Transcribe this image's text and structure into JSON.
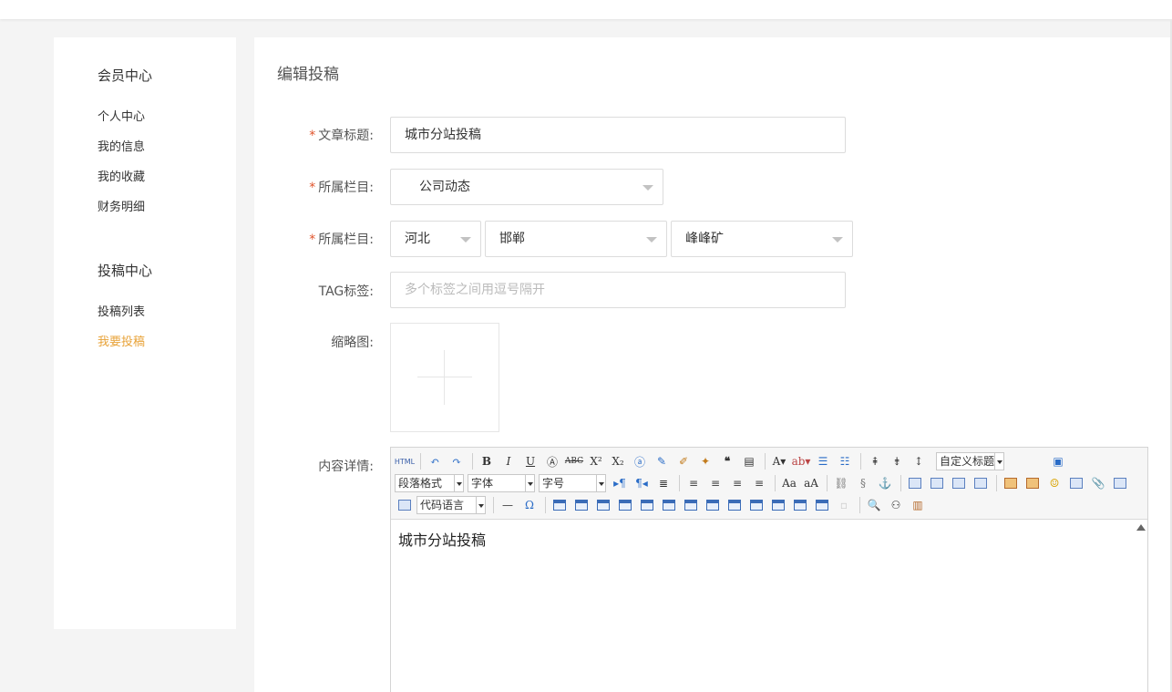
{
  "sidebar": {
    "member_center": "会员中心",
    "member_items": [
      "个人中心",
      "我的信息",
      "我的收藏",
      "财务明细"
    ],
    "submit_center": "投稿中心",
    "submit_items": [
      "投稿列表",
      "我要投稿"
    ],
    "active_item": "我要投稿",
    "active_color": "#e8a33a"
  },
  "main": {
    "title": "编辑投稿",
    "required_mark": "*",
    "fields": {
      "article_title_label": "文章标题:",
      "article_title_value": "城市分站投稿",
      "category_label": "所属栏目:",
      "category_value": "公司动态",
      "region_label": "所属栏目:",
      "province": "河北",
      "city": "邯郸",
      "district": "峰峰矿",
      "tag_label": "TAG标签:",
      "tag_placeholder": "多个标签之间用逗号隔开",
      "thumb_label": "缩略图:",
      "content_label": "内容详情:"
    },
    "editor": {
      "html_label": "HTML",
      "custom_heading": "自定义标题",
      "paragraph_format": "段落格式",
      "font_family": "字体",
      "font_size": "字号",
      "code_language": "代码语言",
      "content": "城市分站投稿"
    }
  },
  "colors": {
    "required": "#e0532b",
    "border": "#dcdcdc"
  }
}
